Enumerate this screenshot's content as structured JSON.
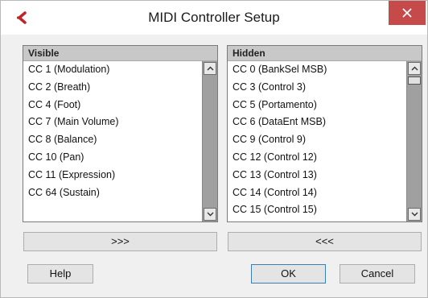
{
  "window": {
    "title": "MIDI Controller Setup",
    "close_icon": "close-icon",
    "app_icon": "cubase-logo-icon",
    "close_color": "#c74a4a"
  },
  "visible_panel": {
    "header": "Visible",
    "items": [
      "CC 1  (Modulation)",
      "CC 2  (Breath)",
      "CC 4  (Foot)",
      "CC 7  (Main Volume)",
      "CC 8  (Balance)",
      "CC 10  (Pan)",
      "CC 11  (Expression)",
      "CC 64  (Sustain)"
    ]
  },
  "hidden_panel": {
    "header": "Hidden",
    "items": [
      "CC 0  (BankSel MSB)",
      "CC 3  (Control 3)",
      "CC 5  (Portamento)",
      "CC 6  (DataEnt MSB)",
      "CC 9  (Control 9)",
      "CC 12  (Control 12)",
      "CC 13  (Control 13)",
      "CC 14  (Control 14)",
      "CC 15  (Control 15)"
    ]
  },
  "buttons": {
    "move_to_hidden": ">>>",
    "move_to_visible": "<<<",
    "help": "Help",
    "ok": "OK",
    "cancel": "Cancel"
  }
}
